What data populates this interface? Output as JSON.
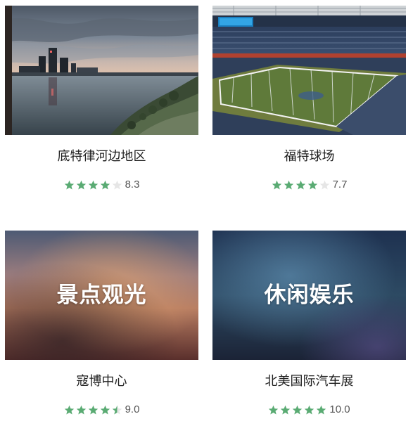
{
  "cards": [
    {
      "title": "底特律河边地区",
      "rating_value": 4.0,
      "score": "8.3",
      "image": "detroit-riverfront-skyline-photo"
    },
    {
      "title": "福特球场",
      "rating_value": 4.0,
      "score": "7.7",
      "image": "ford-field-stadium-photo"
    },
    {
      "title": "寇博中心",
      "rating_value": 4.5,
      "score": "9.0",
      "image": "blurred-placeholder-sightseeing",
      "overlay": "景点观光"
    },
    {
      "title": "北美国际汽车展",
      "rating_value": 5.0,
      "score": "10.0",
      "image": "blurred-placeholder-leisure",
      "overlay": "休闲娱乐"
    }
  ],
  "colors": {
    "star_filled": "#5aab73",
    "star_empty": "#e6e6e6",
    "title_text": "#1f1f1f",
    "score_text": "#555555"
  }
}
